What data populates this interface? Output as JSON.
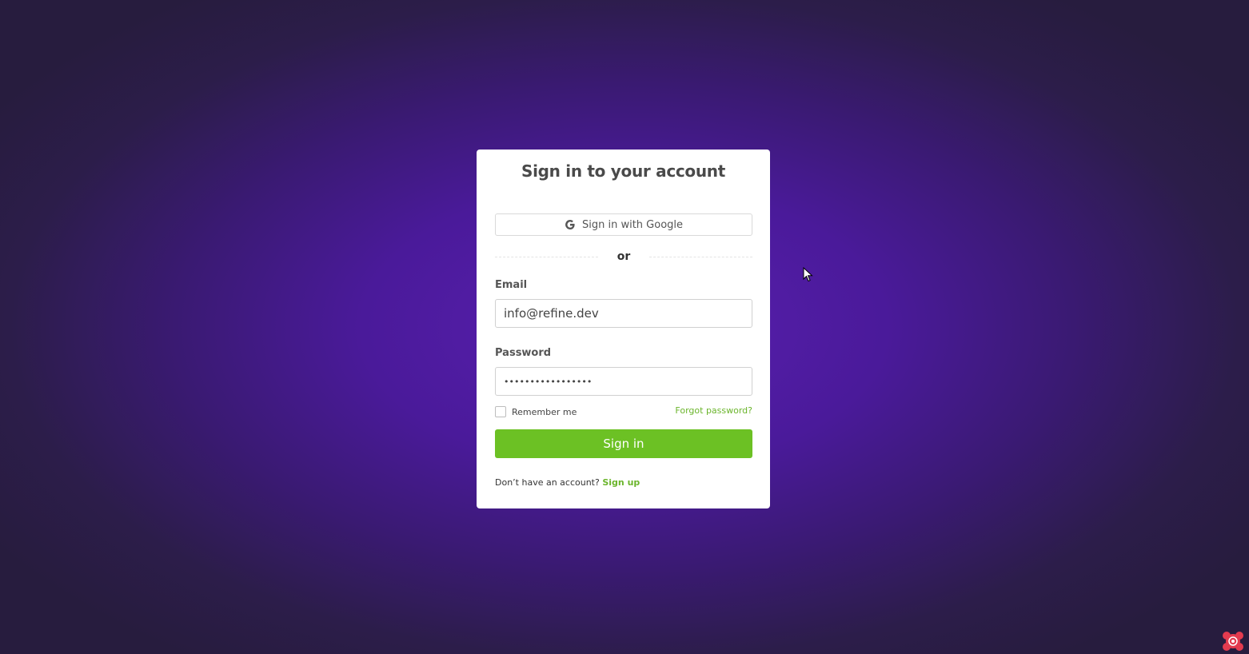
{
  "title": "Sign in to your account",
  "google_button": {
    "label": "Sign in with Google",
    "icon": "google-icon"
  },
  "divider_text": "or",
  "email": {
    "label": "Email",
    "value": "info@refine.dev"
  },
  "password": {
    "label": "Password",
    "value": "•••••••••••••••••"
  },
  "remember_me": {
    "label": "Remember me",
    "checked": false
  },
  "forgot_password": "Forgot password?",
  "signin_button": "Sign in",
  "signup": {
    "prompt": "Don’t have an account?",
    "link": "Sign up"
  },
  "colors": {
    "accent_green": "#6cc124",
    "link_green": "#6bb52c",
    "background_purple": "#4a1a9a"
  }
}
